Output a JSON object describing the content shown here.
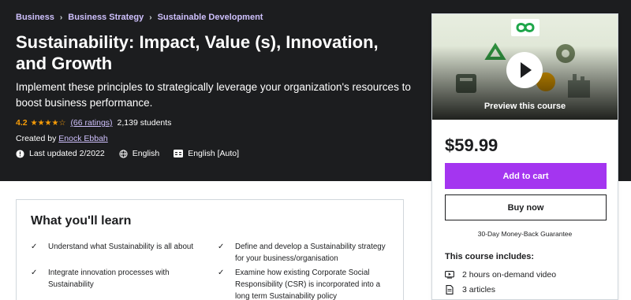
{
  "breadcrumb": [
    "Business",
    "Business Strategy",
    "Sustainable Development"
  ],
  "course": {
    "title": "Sustainability: Impact, Value (s), Innovation, and Growth",
    "subtitle": "Implement these principles to strategically leverage your organization's resources to boost business performance.",
    "rating": "4.2",
    "stars": "★★★★☆",
    "ratings_count": "(66 ratings)",
    "students": "2,139 students",
    "created_by_label": "Created by",
    "instructor": "Enock Ebbah",
    "last_updated": "Last updated 2/2022",
    "language": "English",
    "captions": "English [Auto]"
  },
  "sidebar": {
    "preview_label": "Preview this course",
    "price": "$59.99",
    "add_to_cart": "Add to cart",
    "buy_now": "Buy now",
    "guarantee": "30-Day Money-Back Guarantee",
    "includes_title": "This course includes:",
    "includes": [
      "2 hours on-demand video",
      "3 articles"
    ]
  },
  "learn": {
    "title": "What you'll learn",
    "items": [
      "Understand what Sustainability is all about",
      "Define and develop a Sustainability strategy for your business/organisation",
      "Integrate innovation processes with Sustainability",
      "Examine how existing Corporate Social Responsibility (CSR) is incorporated into a long term Sustainability policy"
    ]
  },
  "colors": {
    "hero_bg": "#1c1d1f",
    "accent_purple": "#a435f0",
    "link_purple": "#cec0fc",
    "star": "#f69c08"
  },
  "icons": [
    "alert-icon",
    "globe-icon",
    "captions-icon",
    "play-icon",
    "video-icon",
    "article-icon",
    "check-icon",
    "sustainability-logo-icon"
  ]
}
